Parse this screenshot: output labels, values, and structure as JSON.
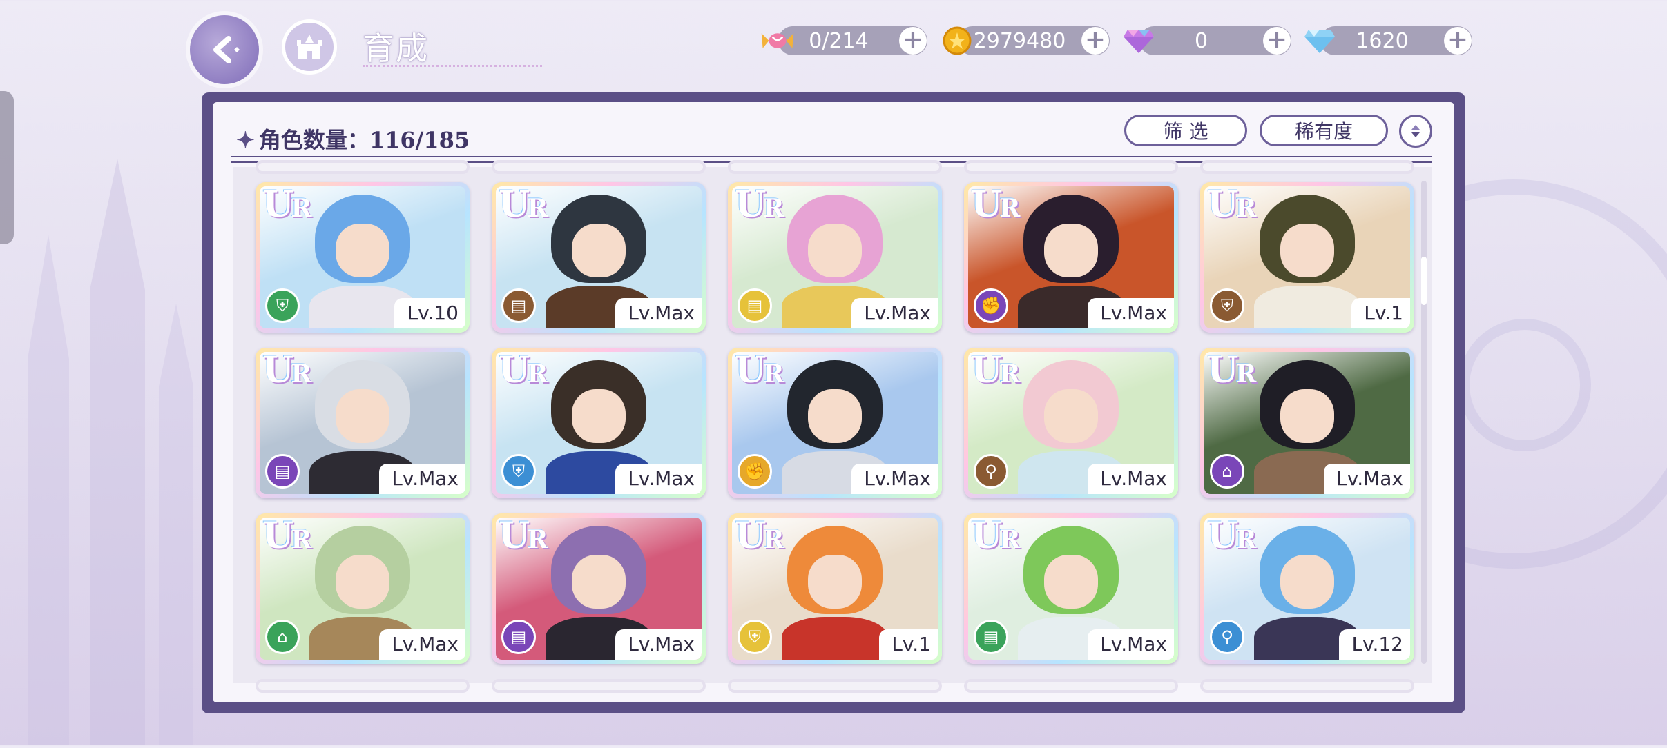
{
  "header": {
    "title": "育成"
  },
  "currencies": [
    {
      "icon": "candy-icon",
      "value": "0/214"
    },
    {
      "icon": "gold-coin-icon",
      "value": "2979480"
    },
    {
      "icon": "pink-diamond-icon",
      "value": "0"
    },
    {
      "icon": "blue-diamond-icon",
      "value": "1620"
    }
  ],
  "panel": {
    "count_label": "角色数量：116/185",
    "filter_label": "筛 选",
    "rarity_label": "稀有度"
  },
  "cards": [
    {
      "rarity": "UR",
      "level": "Lv.10",
      "role_color": "#3aa35a",
      "role_icon": "shield-icon",
      "hair": "#6aa8e8",
      "bg": "#bfe0f5",
      "outfit": "#e8e6ee"
    },
    {
      "rarity": "UR",
      "level": "Lv.Max",
      "role_color": "#8a5a32",
      "role_icon": "book-icon",
      "hair": "#2e3640",
      "bg": "#c7e3f2",
      "outfit": "#5b3b28"
    },
    {
      "rarity": "UR",
      "level": "Lv.Max",
      "role_color": "#e6c23a",
      "role_icon": "book-icon",
      "hair": "#e7a3d4",
      "bg": "#d6e9d0",
      "outfit": "#e8c85a"
    },
    {
      "rarity": "UR",
      "level": "Lv.Max",
      "role_color": "#7a46b8",
      "role_icon": "fist-icon",
      "hair": "#2a1e2e",
      "bg": "#c9552a",
      "outfit": "#3a2a2a"
    },
    {
      "rarity": "UR",
      "level": "Lv.1",
      "role_color": "#8a5a32",
      "role_icon": "shield-icon",
      "hair": "#4b4a2c",
      "bg": "#e9d4b8",
      "outfit": "#f0ebe0"
    },
    {
      "rarity": "UR",
      "level": "Lv.Max",
      "role_color": "#7a46b8",
      "role_icon": "book-icon",
      "hair": "#d9dde4",
      "bg": "#b6c4d4",
      "outfit": "#2d2b33"
    },
    {
      "rarity": "UR",
      "level": "Lv.Max",
      "role_color": "#3c8fd4",
      "role_icon": "shield-icon",
      "hair": "#3a2f28",
      "bg": "#c7e3f2",
      "outfit": "#2d4aa0"
    },
    {
      "rarity": "UR",
      "level": "Lv.Max",
      "role_color": "#e6a82a",
      "role_icon": "fist-icon",
      "hair": "#22262e",
      "bg": "#a9c8ee",
      "outfit": "#d7dbe4"
    },
    {
      "rarity": "UR",
      "level": "Lv.Max",
      "role_color": "#8a5a32",
      "role_icon": "key-icon",
      "hair": "#f2c9d2",
      "bg": "#d4eac6",
      "outfit": "#cfe6ef"
    },
    {
      "rarity": "UR",
      "level": "Lv.Max",
      "role_color": "#7a46b8",
      "role_icon": "boot-icon",
      "hair": "#1f1e26",
      "bg": "#4f6a44",
      "outfit": "#8a6a52"
    },
    {
      "rarity": "UR",
      "level": "Lv.Max",
      "role_color": "#3aa35a",
      "role_icon": "boot-icon",
      "hair": "#b5cfa0",
      "bg": "#cfe6c0",
      "outfit": "#a6875a"
    },
    {
      "rarity": "UR",
      "level": "Lv.Max",
      "role_color": "#7a46b8",
      "role_icon": "book-icon",
      "hair": "#8d6fb0",
      "bg": "#d45a7a",
      "outfit": "#2a2630"
    },
    {
      "rarity": "UR",
      "level": "Lv.1",
      "role_color": "#e6c23a",
      "role_icon": "shield-icon",
      "hair": "#ee8a3a",
      "bg": "#e9dccb",
      "outfit": "#c8342a"
    },
    {
      "rarity": "UR",
      "level": "Lv.Max",
      "role_color": "#3aa35a",
      "role_icon": "book-icon",
      "hair": "#7ec85a",
      "bg": "#dfeee0",
      "outfit": "#e6eef0"
    },
    {
      "rarity": "UR",
      "level": "Lv.12",
      "role_color": "#3c8fd4",
      "role_icon": "key-icon",
      "hair": "#6ab0e8",
      "bg": "#cfe3f3",
      "outfit": "#3a3656"
    }
  ]
}
